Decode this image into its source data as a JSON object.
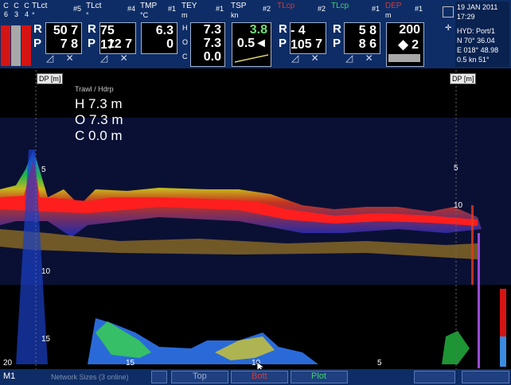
{
  "gauges": {
    "labels": [
      "C",
      "C",
      "C",
      "6",
      "3",
      "4"
    ],
    "bar_colors": [
      "#d51414",
      "#a8a8a8",
      "#d51414"
    ]
  },
  "panels": [
    {
      "title": "TLct",
      "unit": "°",
      "num": "#5",
      "r": "50 7",
      "p": "7 8"
    },
    {
      "title": "TLct",
      "unit": "°",
      "num": "#4",
      "r": "75 17",
      "p": "12 7"
    },
    {
      "title": "TMP",
      "unit": "°C",
      "num": "#1",
      "v1": "6.3",
      "v2": "0"
    },
    {
      "title": "TEY",
      "unit": "m",
      "num": "#1",
      "h": "7.3",
      "o": "7.3",
      "c": "0.0"
    },
    {
      "title": "TSP",
      "unit": "kn",
      "num": "#2",
      "v1": "3.8",
      "v2": "0.5◄"
    },
    {
      "title": "TLcp",
      "unit": "",
      "num": "#2",
      "r": "- 4 10",
      "p": "5 7"
    },
    {
      "title": "TLcp",
      "unit": "",
      "num": "#1",
      "r": "5 8",
      "p": "8 6"
    },
    {
      "title": "DEP",
      "unit": "m",
      "num": "#1",
      "v1": "200",
      "v2": "◆ 2"
    }
  ],
  "letters": {
    "r": "R",
    "p": "P",
    "h": "H",
    "o": "O",
    "c": "C"
  },
  "icons": {
    "tilt": "◿",
    "cross": "✕"
  },
  "info": {
    "date": "19 JAN 2011",
    "time": "17:29",
    "hyd": "HYD: Port/1",
    "lat": "N  70° 36.04",
    "lon": "E 018° 48.98",
    "speed": "0.5 kn   51°"
  },
  "echogram": {
    "dp_left": "DP [m]",
    "dp_right": "DP [m]",
    "header": "Trawl / Hdrp",
    "rows": [
      {
        "k": "H",
        "v": "7.3 m"
      },
      {
        "k": "O",
        "v": "7.3 m"
      },
      {
        "k": "C",
        "v": "0.0 m"
      }
    ],
    "scale_left": [
      "5",
      "10",
      "15"
    ],
    "scale_right": [
      "5",
      "10"
    ],
    "bottom_ticks": [
      "20",
      "15",
      "10",
      "5"
    ]
  },
  "bottom": {
    "mode": "M1",
    "status": "Network Sizes (3 online)",
    "buttons": [
      "Top",
      "Bott",
      "Plot"
    ]
  }
}
